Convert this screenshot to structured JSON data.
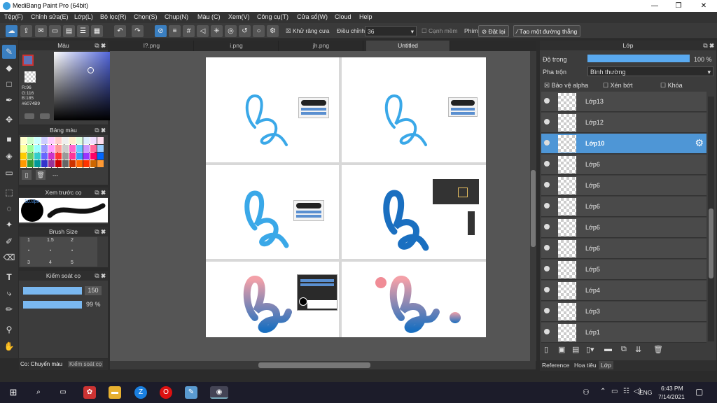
{
  "window": {
    "title": "MediBang Paint Pro (64bit)",
    "minimize": "—",
    "maximize": "❐",
    "close": "✕"
  },
  "menu": [
    "Tệp(F)",
    "Chỉnh sửa(E)",
    "Lớp(L)",
    "Bộ lọc(R)",
    "Chọn(S)",
    "Chụp(N)",
    "Màu (C)",
    "Xem(V)",
    "Công cụ(T)",
    "Cửa sổ(W)",
    "Cloud",
    "Help"
  ],
  "toolbar": {
    "antialias_label": "Khử răng cưa",
    "adjust_label": "Điều chỉnh",
    "adjust_value": "36",
    "edge_label": "Cạnh mềm",
    "key_label": "Phím",
    "reset_label": "Đặt lại",
    "straight_line_label": "Tạo một đường thẳng"
  },
  "color_panel": {
    "title": "Màu",
    "r": "R:96",
    "g": "G:116",
    "b": "B:185",
    "hex": "#6074B9",
    "fg_color": "#6074B9"
  },
  "palette_panel": {
    "title": "Bảng màu",
    "name": "---"
  },
  "brush_preview_panel": {
    "title": "Xem trước cọ",
    "size": "10.8px"
  },
  "brush_size_panel": {
    "title": "Brush Size",
    "labels": [
      "1",
      "1.5",
      "2",
      "3",
      "4",
      "5"
    ]
  },
  "brush_control_panel": {
    "title": "Kiểm soát cọ",
    "size_value": "150",
    "opacity_value": "99 %"
  },
  "bottom_tabs": [
    "Co: Chuyển màu",
    "Kiểm soát cọ"
  ],
  "tabs": [
    "l?.png",
    "i.png",
    "jh.png",
    "Untitled"
  ],
  "layer_panel": {
    "title": "Lớp",
    "opacity_label": "Độ trong",
    "opacity_value": "100 %",
    "blend_label": "Pha trộn",
    "blend_value": "Bình thường",
    "protect_alpha": "Bảo vệ alpha",
    "clipping": "Xén bớt",
    "lock": "Khóa",
    "layers": [
      "Lớp13",
      "Lớp12",
      "Lớp10",
      "Lớp6",
      "Lớp6",
      "Lớp6",
      "Lớp6",
      "Lớp6",
      "Lớp5",
      "Lớp4",
      "Lớp3",
      "Lớp1"
    ],
    "selected_index": 2,
    "bottom_tabs": [
      "Reference",
      "Hoa tiêu",
      "Lớp"
    ]
  },
  "taskbar": {
    "lang": "ENG",
    "time": "6:43 PM",
    "date": "7/14/2021"
  },
  "colors": {
    "accent": "#3a7fc1",
    "layer_selected": "#4e96d6",
    "lettering": "#3aa8e8"
  }
}
